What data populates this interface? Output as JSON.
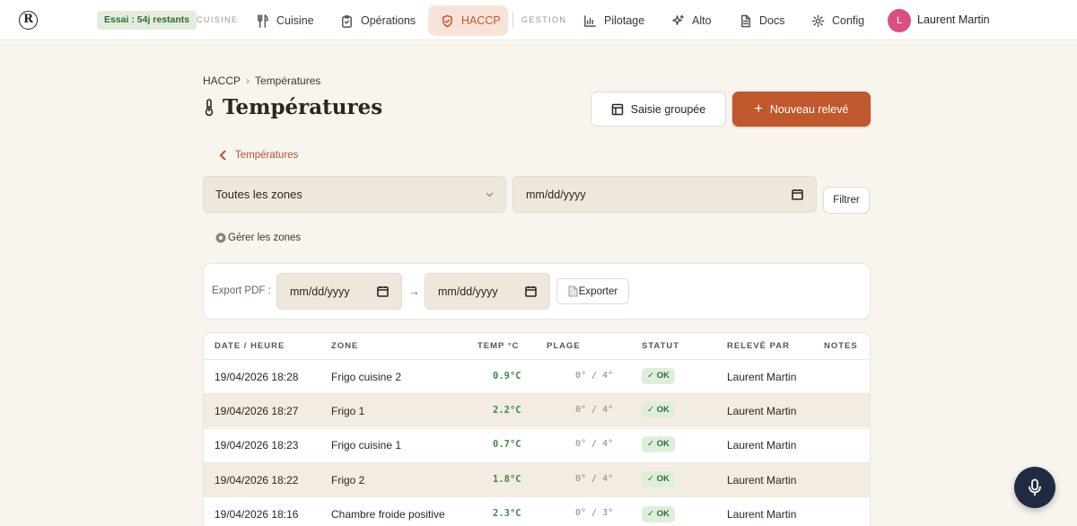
{
  "nav": {
    "logo": "R",
    "trial_badge": "Essai : 54j restants",
    "section_cuisine": "CUISINE",
    "section_gestion": "GESTION",
    "items": [
      {
        "label": "Cuisine",
        "icon": "utensils-icon"
      },
      {
        "label": "Opérations",
        "icon": "clipboard-icon"
      },
      {
        "label": "HACCP",
        "icon": "shield-icon",
        "active": true
      },
      {
        "label": "Pilotage",
        "icon": "bar-chart-icon"
      },
      {
        "label": "Alto",
        "icon": "sparkles-icon"
      },
      {
        "label": "Docs",
        "icon": "document-icon"
      },
      {
        "label": "Config",
        "icon": "gear-icon"
      }
    ],
    "user": {
      "initial": "L",
      "name": "Laurent Martin",
      "avatar_color": "#d94d84"
    }
  },
  "header": {
    "breadcrumb": [
      "HACCP",
      "Températures"
    ],
    "title": "Températures",
    "btn_grouped": "Saisie groupée",
    "btn_new": "Nouveau relevé"
  },
  "back_link": "Températures",
  "filters": {
    "zone_select": "Toutes les zones",
    "date_placeholder": "mm/dd/yyyy",
    "btn_filter": "Filtrer",
    "manage_zones": "Gérer les zones"
  },
  "export": {
    "label": "Export PDF :",
    "from_placeholder": "mm/dd/yyyy",
    "to_placeholder": "mm/dd/yyyy",
    "arrow": "→",
    "btn": "Exporter"
  },
  "table": {
    "columns": [
      "DATE / HEURE",
      "ZONE",
      "TEMP °C",
      "PLAGE",
      "STATUT",
      "RELEVÉ PAR",
      "NOTES"
    ],
    "rows": [
      {
        "datetime": "19/04/2026 18:28",
        "zone": "Frigo cuisine 2",
        "temp": "0.9°C",
        "range": "0° / 4°",
        "status": "✓ OK",
        "by": "Laurent Martin",
        "notes": ""
      },
      {
        "datetime": "19/04/2026 18:27",
        "zone": "Frigo 1",
        "temp": "2.2°C",
        "range": "0° / 4°",
        "status": "✓ OK",
        "by": "Laurent Martin",
        "notes": ""
      },
      {
        "datetime": "19/04/2026 18:23",
        "zone": "Frigo cuisine 1",
        "temp": "0.7°C",
        "range": "0° / 4°",
        "status": "✓ OK",
        "by": "Laurent Martin",
        "notes": ""
      },
      {
        "datetime": "19/04/2026 18:22",
        "zone": "Frigo 2",
        "temp": "1.8°C",
        "range": "0° / 4°",
        "status": "✓ OK",
        "by": "Laurent Martin",
        "notes": ""
      },
      {
        "datetime": "19/04/2026 18:16",
        "zone": "Chambre froide positive",
        "temp": "2.3°C",
        "range": "0° / 3°",
        "status": "✓ OK",
        "by": "Laurent Martin",
        "notes": ""
      }
    ]
  },
  "colors": {
    "accent": "#c0582d",
    "ok": "#3d8a48",
    "background": "#f8f4ee"
  }
}
